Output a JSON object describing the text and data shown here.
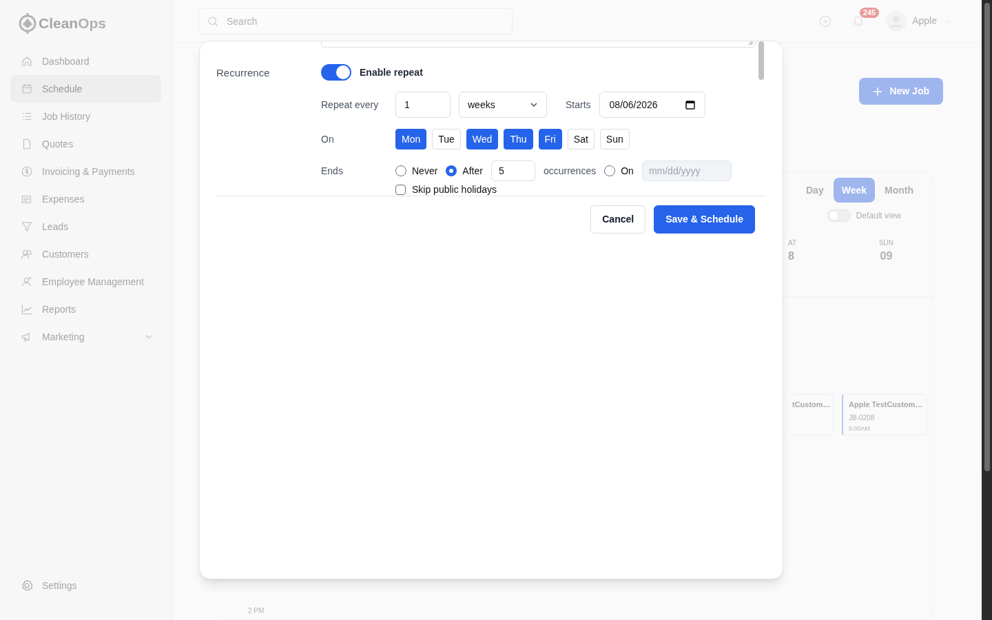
{
  "logo": {
    "first": "Clean",
    "second": "Ops"
  },
  "sidebar": {
    "items": [
      {
        "label": "Dashboard",
        "selected": false
      },
      {
        "label": "Schedule",
        "selected": true
      },
      {
        "label": "Job History",
        "selected": false
      },
      {
        "label": "Quotes",
        "selected": false
      },
      {
        "label": "Invoicing & Payments",
        "selected": false
      },
      {
        "label": "Expenses",
        "selected": false
      },
      {
        "label": "Leads",
        "selected": false
      },
      {
        "label": "Customers",
        "selected": false
      },
      {
        "label": "Employee Management",
        "selected": false
      },
      {
        "label": "Reports",
        "selected": false
      },
      {
        "label": "Marketing",
        "selected": false,
        "expandable": true
      }
    ],
    "footer": {
      "label": "Settings"
    }
  },
  "header": {
    "search_placeholder": "Search",
    "notification_count": "245",
    "user": "Apple"
  },
  "background": {
    "new_job": "New Job",
    "view_tabs": [
      {
        "label": "Day",
        "selected": false
      },
      {
        "label": "Week",
        "selected": true
      },
      {
        "label": "Month",
        "selected": false
      }
    ],
    "default_view": {
      "label": "Default view",
      "on": false
    },
    "day_columns": [
      {
        "day": "AT",
        "date": "8"
      },
      {
        "day": "SUN",
        "date": "09"
      }
    ],
    "events": [
      {
        "title": "tCustom…"
      },
      {
        "title": "Apple TestCustom…",
        "id": "JB-0208",
        "time": "9:00AM"
      }
    ],
    "time_label": "2 PM"
  },
  "dialog": {
    "recurrence": {
      "label": "Recurrence",
      "enable_repeat": {
        "label": "Enable repeat",
        "on": true
      },
      "repeat_every": {
        "label": "Repeat every",
        "value": "1",
        "unit": "weeks"
      },
      "starts": {
        "label": "Starts",
        "value": "08/06/2026"
      },
      "on": {
        "label": "On",
        "days": [
          {
            "label": "Mon",
            "selected": true
          },
          {
            "label": "Tue",
            "selected": false
          },
          {
            "label": "Wed",
            "selected": true
          },
          {
            "label": "Thu",
            "selected": true
          },
          {
            "label": "Fri",
            "selected": true
          },
          {
            "label": "Sat",
            "selected": false
          },
          {
            "label": "Sun",
            "selected": false
          }
        ]
      },
      "ends": {
        "label": "Ends",
        "options": [
          {
            "kind": "plain",
            "label": "Never",
            "selected": false
          },
          {
            "kind": "count",
            "label": "After",
            "selected": true,
            "value": "5",
            "suffix": "occurrences"
          },
          {
            "kind": "date",
            "label": "On",
            "selected": false,
            "placeholder": "mm/dd/yyyy"
          }
        ]
      },
      "skip_holidays": {
        "label": "Skip public holidays",
        "checked": false
      }
    },
    "buttons": [
      {
        "kind": "secondary",
        "label": "Cancel"
      },
      {
        "kind": "primary",
        "label": "Save & Schedule"
      }
    ]
  }
}
